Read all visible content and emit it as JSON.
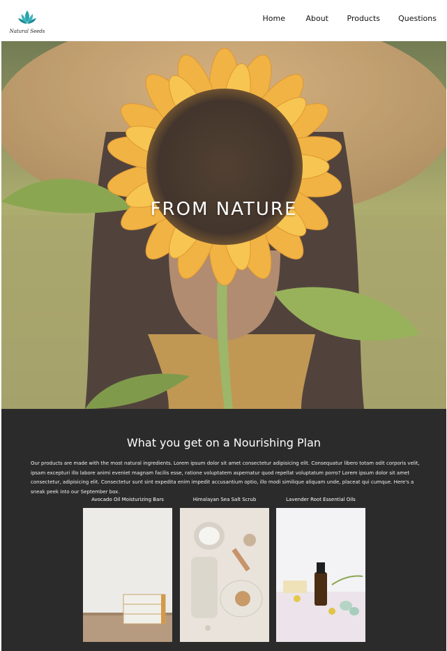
{
  "brand": {
    "logo_text": "Natural Seeds",
    "accent": "#2fa3ad"
  },
  "nav": {
    "items": [
      {
        "label": "Home"
      },
      {
        "label": "About"
      },
      {
        "label": "Products"
      },
      {
        "label": "Questions"
      }
    ]
  },
  "hero": {
    "title": "FROM NATURE"
  },
  "plan": {
    "title": "What you get on a Nourishing Plan",
    "text": "Our products are made with the most natural ingredients. Lorem ipsum dolor sit amet consectetur adipisicing elit. Consequatur libero totam odit corporis velit, ipsam excepturi illo labore animi eveniet magnam facilis esse, ratione voluptatem aspernatur quod repellat voluptatum porro? Lorem ipsum dolor sit amet consectetur, adipisicing elit. Consectetur sunt sint expedita enim impedit accusantium optio, illo modi similique aliquam unde, placeat qui cumque. Here's a sneak peek into our September box.",
    "products": [
      {
        "name": "Avocado Oil Moisturizing Bars"
      },
      {
        "name": "Himalayan Sea Salt Scrub"
      },
      {
        "name": "Lavender Root Essential Oils"
      }
    ]
  }
}
